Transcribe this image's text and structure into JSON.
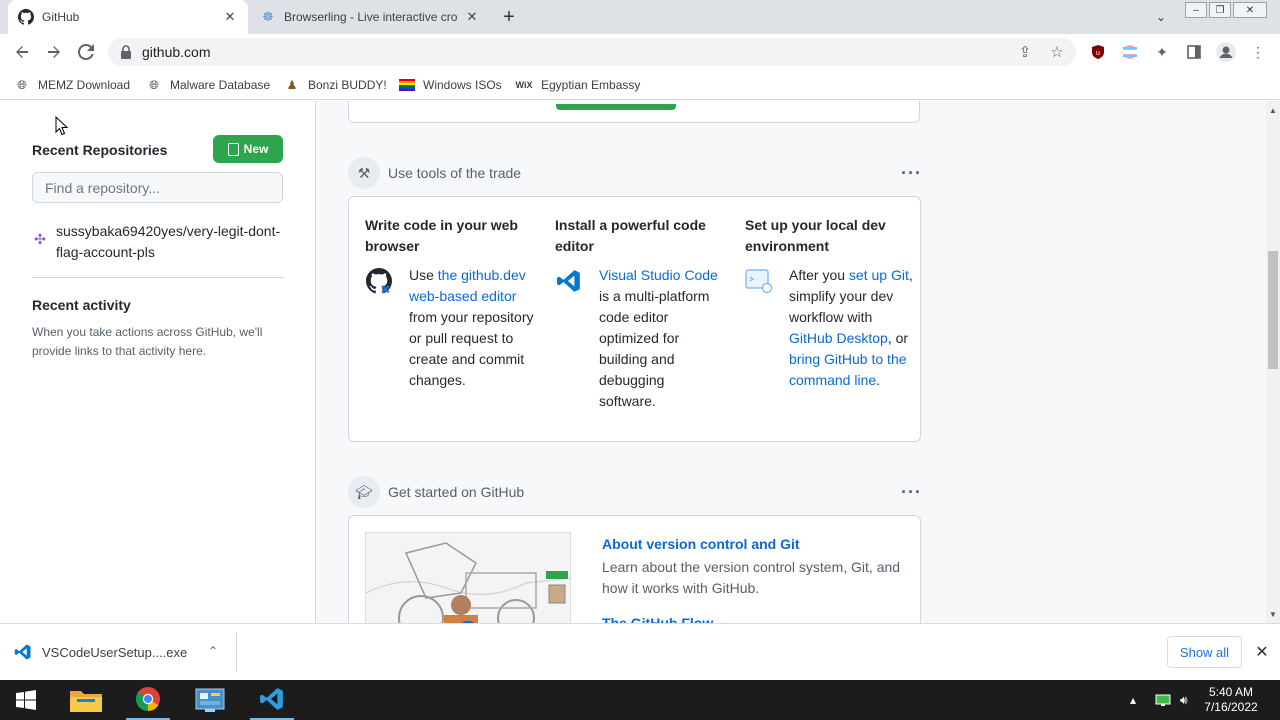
{
  "browser": {
    "tabs": [
      {
        "title": "GitHub",
        "active": true
      },
      {
        "title": "Browserling - Live interactive cro",
        "active": false
      }
    ],
    "url": "github.com",
    "bookmarks": [
      "MEMZ Download",
      "Malware Database",
      "Bonzi BUDDY!",
      "Windows ISOs",
      "Egyptian Embassy"
    ],
    "bookmark_wix_label": "WiX"
  },
  "sidebar": {
    "recent_repos_title": "Recent Repositories",
    "new_button": "New",
    "find_placeholder": "Find a repository...",
    "repo": "sussybaka69420yes/very-legit-dont-flag-account-pls",
    "recent_activity_title": "Recent activity",
    "recent_activity_text": "When you take actions across GitHub, we'll provide links to that activity here."
  },
  "tools": {
    "heading": "Use tools of the trade",
    "col1": {
      "title": "Write code in your web browser",
      "pre": "Use ",
      "link": "the github.dev web-based editor",
      "post": " from your repository or pull request to create and commit changes."
    },
    "col2": {
      "title": "Install a powerful code editor",
      "link": "Visual Studio Code",
      "post": " is a multi-platform code editor optimized for building and debugging software."
    },
    "col3": {
      "title": "Set up your local dev environment",
      "pre": "After you ",
      "link1": "set up Git",
      "mid1": ", simplify your dev workflow with ",
      "link2": "GitHub Desktop",
      "mid2": ", or ",
      "link3": "bring GitHub to the command line",
      "post": "."
    }
  },
  "get_started": {
    "heading": "Get started on GitHub",
    "item1_title": "About version control and Git",
    "item1_desc": "Learn about the version control system, Git, and how it works with GitHub.",
    "item2_title": "The GitHub Flow"
  },
  "downloads": {
    "file": "VSCodeUserSetup....exe",
    "show_all": "Show all"
  },
  "taskbar": {
    "time": "5:40 AM",
    "date": "7/16/2022"
  },
  "colors": {
    "accent": "#0969da",
    "green_button": "#2da44e",
    "taskbar": "#1c1c1c"
  }
}
